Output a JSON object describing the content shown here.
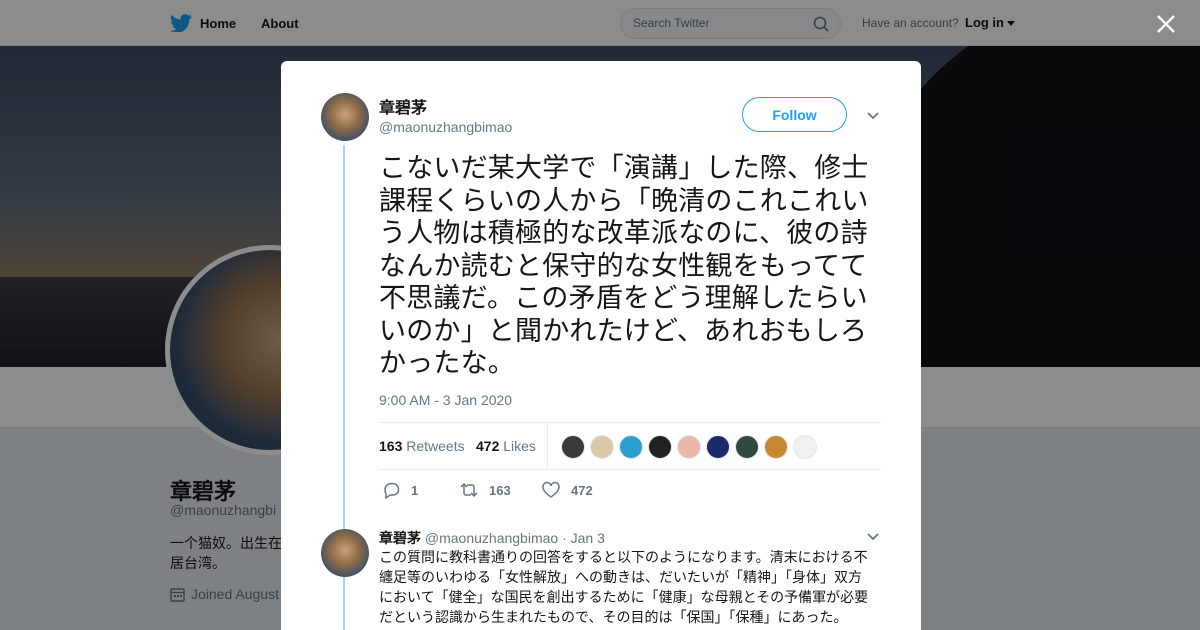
{
  "nav": {
    "home_label": "Home",
    "about_label": "About",
    "search_placeholder": "Search Twitter",
    "account_prompt": "Have an account?",
    "login_label": "Log in"
  },
  "profile": {
    "name": "章碧茅",
    "handle": "@maonuzhangbi",
    "bio": "一个猫奴。出生在居台湾。",
    "joined": "Joined August"
  },
  "tweet": {
    "author_name": "章碧茅",
    "author_handle": "@maonuzhangbimao",
    "follow_label": "Follow",
    "text": "こないだ某大学で「演講」した際、修士課程くらいの人から「晩清のこれこれいう人物は積極的な改革派なのに、彼の詩なんか読むと保守的な女性観をもってて不思議だ。この矛盾をどう理解したらいいのか」と聞かれたけど、あれおもしろかったな。",
    "timestamp": "9:00 AM - 3 Jan 2020",
    "retweets_count": "163",
    "retweets_label": "Retweets",
    "likes_count": "472",
    "likes_label": "Likes",
    "reply_count": "1",
    "retweet_count_action": "163",
    "like_count_action": "472"
  },
  "reply": {
    "author_name": "章碧茅",
    "author_handle": "@maonuzhangbimao",
    "date": "· Jan 3",
    "text": "この質問に教科書通りの回答をすると以下のようになります。清末における不纏足等のいわゆる「女性解放」への動きは、だいたいが「精神」「身体」双方において「健全」な国民を創出するために「健康」な母親とその予備軍が必要だという認識から生まれたもので、その目的は「保国」「保種」にあった。"
  },
  "liker_colors": [
    "#3a3a3a",
    "#d9c9a8",
    "#2b9fd1",
    "#222222",
    "#e9b8a8",
    "#1b2a6b",
    "#2f4a3a",
    "#c7872e",
    "#f0f0f0"
  ],
  "colors": {
    "accent": "#1da1f2",
    "thread_line": "#a6d6f7",
    "like_red": "#e0245e"
  }
}
